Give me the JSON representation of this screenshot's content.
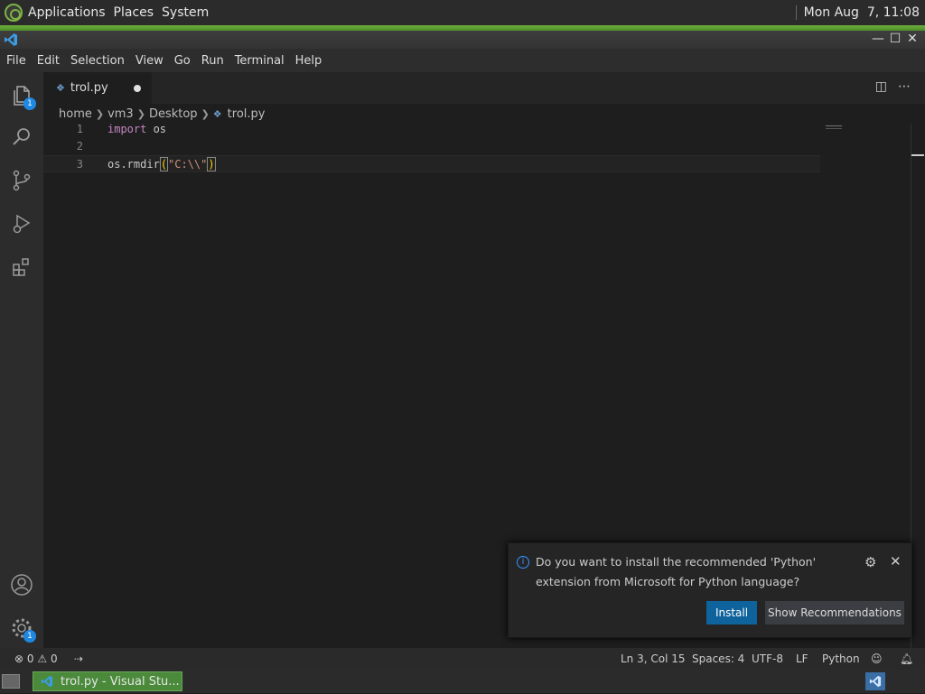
{
  "top_panel": {
    "menus": [
      "Applications",
      "Places",
      "System"
    ],
    "clock": "Mon Aug  7, 11:08"
  },
  "menubar": [
    "File",
    "Edit",
    "Selection",
    "View",
    "Go",
    "Run",
    "Terminal",
    "Help"
  ],
  "activity_bar": {
    "explorer_badge": "1",
    "settings_badge": "1"
  },
  "tab": {
    "filename": "trol.py",
    "unsaved": true
  },
  "breadcrumb": [
    "home",
    "vm3",
    "Desktop",
    "trol.py"
  ],
  "editor": {
    "lines": [
      {
        "num": "1",
        "parts": [
          {
            "t": "import",
            "c": "kw"
          },
          {
            "t": " os",
            "c": ""
          }
        ]
      },
      {
        "num": "2",
        "parts": []
      },
      {
        "num": "3",
        "parts": [
          {
            "t": "os.rmdir",
            "c": ""
          },
          {
            "t": "(",
            "c": "brk"
          },
          {
            "t": "\"C:\\\\\"",
            "c": "str"
          },
          {
            "t": ")",
            "c": "brk"
          }
        ]
      }
    ],
    "current_line": "3"
  },
  "notification": {
    "message": "Do you want to install the recommended 'Python' extension from Microsoft for Python language?",
    "install_label": "Install",
    "show_label": "Show Recommendations"
  },
  "statusbar": {
    "errors": "0",
    "warnings": "0",
    "position": "Ln 3, Col 15",
    "spaces": "Spaces: 4",
    "encoding": "UTF-8",
    "eol": "LF",
    "language": "Python"
  },
  "taskbar": {
    "task_label": "trol.py - Visual Stu..."
  },
  "colors": {
    "accent_blue": "#0e639c",
    "panel_green": "#6bb03c",
    "badge_blue": "#1e88e5"
  }
}
